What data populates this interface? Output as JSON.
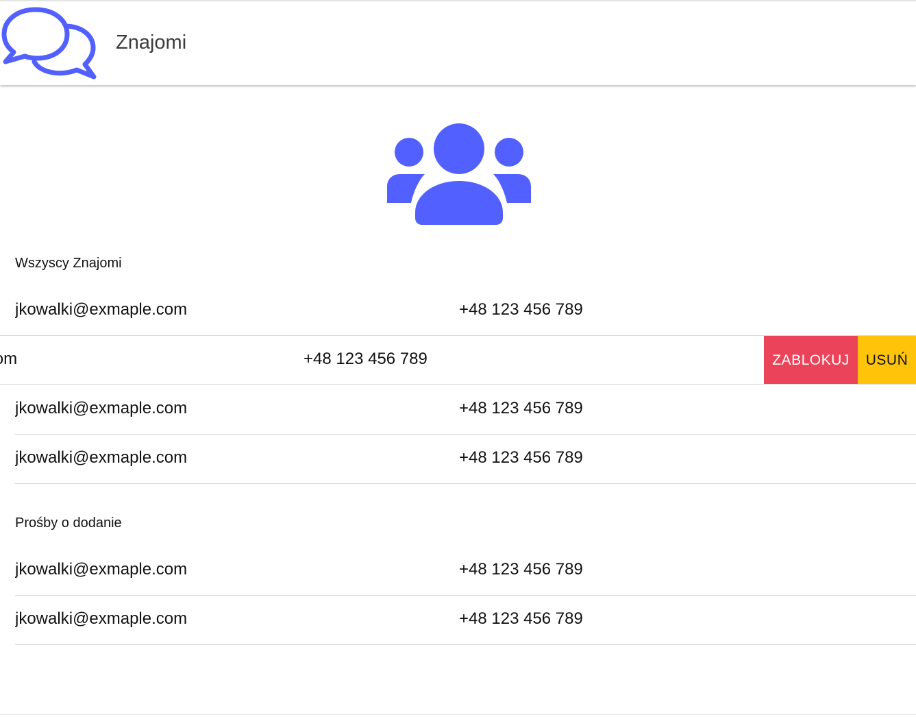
{
  "header": {
    "title": "Znajomi",
    "logo_icon": "chat-bubbles-icon"
  },
  "hero": {
    "icon": "people-group-icon",
    "color": "#5260ff"
  },
  "colors": {
    "accent": "#5260ff",
    "danger": "#eb445a",
    "warning": "#ffc409"
  },
  "friends": {
    "header": "Wszyscy Znajomi",
    "rows": [
      {
        "email": "jkowalki@exmaple.com",
        "phone": "+48 123 456 789"
      },
      {
        "email": "jkowalki@exmaple.com",
        "phone": "+48 123 456 789",
        "swiped": true,
        "actions": {
          "block": "ZABLOKUJ",
          "remove": "USUŃ"
        }
      },
      {
        "email": "jkowalki@exmaple.com",
        "phone": "+48 123 456 789"
      },
      {
        "email": "jkowalki@exmaple.com",
        "phone": "+48 123 456 789"
      }
    ]
  },
  "requests": {
    "header": "Prośby o dodanie",
    "rows": [
      {
        "email": "jkowalki@exmaple.com",
        "phone": "+48 123 456 789"
      },
      {
        "email": "jkowalki@exmaple.com",
        "phone": "+48 123 456 789"
      }
    ]
  }
}
